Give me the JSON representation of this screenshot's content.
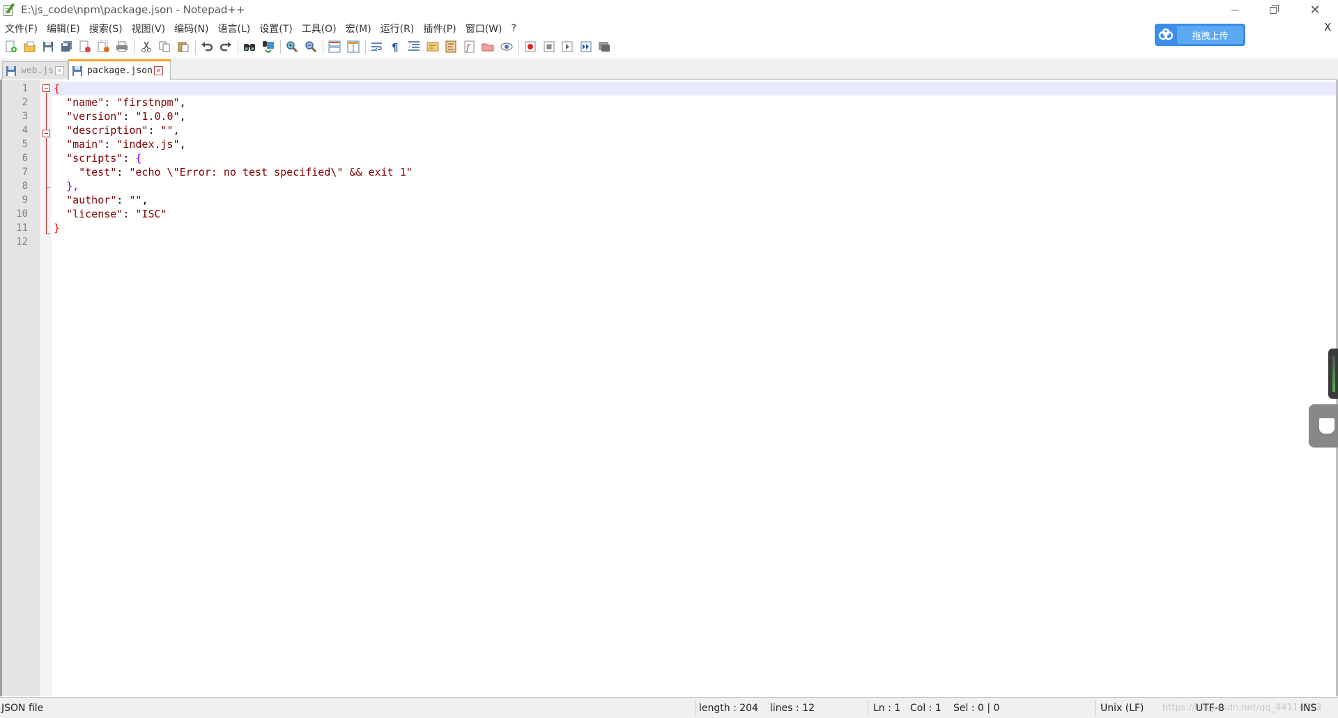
{
  "window": {
    "title": "E:\\js_code\\npm\\package.json - Notepad++"
  },
  "menu": {
    "items": [
      "文件(F)",
      "编辑(E)",
      "搜索(S)",
      "视图(V)",
      "编码(N)",
      "语言(L)",
      "设置(T)",
      "工具(O)",
      "宏(M)",
      "运行(R)",
      "插件(P)",
      "窗口(W)",
      "?"
    ],
    "close_x": "X"
  },
  "upload": {
    "label": "拖拽上传"
  },
  "toolbar": {
    "icons": [
      "new-file-icon",
      "open-file-icon",
      "save-icon",
      "save-all-icon",
      "close-icon",
      "close-all-icon",
      "print-icon",
      "cut-icon",
      "copy-icon",
      "paste-icon",
      "undo-icon",
      "redo-icon",
      "find-icon",
      "replace-icon",
      "zoom-in-icon",
      "zoom-out-icon",
      "sync-vertical-icon",
      "sync-horizontal-icon",
      "word-wrap-icon",
      "show-all-chars-icon",
      "indent-guide-icon",
      "user-language-icon",
      "doc-map-icon",
      "function-list-icon",
      "folder-workspace-icon",
      "monitor-icon",
      "record-macro-icon",
      "stop-macro-icon",
      "play-macro-icon",
      "run-macro-multiple-icon",
      "save-macro-icon"
    ]
  },
  "tabs": [
    {
      "label": "web.js",
      "active": false
    },
    {
      "label": "package.json",
      "active": true
    }
  ],
  "editor": {
    "lines": [
      [
        {
          "t": "{",
          "c": "brace"
        }
      ],
      [
        {
          "t": "  ",
          "c": "op"
        },
        {
          "t": "\"name\"",
          "c": "key"
        },
        {
          "t": ": ",
          "c": "op"
        },
        {
          "t": "\"firstnpm\"",
          "c": "str"
        },
        {
          "t": ",",
          "c": "op"
        }
      ],
      [
        {
          "t": "  ",
          "c": "op"
        },
        {
          "t": "\"version\"",
          "c": "key"
        },
        {
          "t": ": ",
          "c": "op"
        },
        {
          "t": "\"1.0.0\"",
          "c": "str"
        },
        {
          "t": ",",
          "c": "op"
        }
      ],
      [
        {
          "t": "  ",
          "c": "op"
        },
        {
          "t": "\"description\"",
          "c": "key"
        },
        {
          "t": ": ",
          "c": "op"
        },
        {
          "t": "\"\"",
          "c": "str"
        },
        {
          "t": ",",
          "c": "op"
        }
      ],
      [
        {
          "t": "  ",
          "c": "op"
        },
        {
          "t": "\"main\"",
          "c": "key"
        },
        {
          "t": ": ",
          "c": "op"
        },
        {
          "t": "\"index.js\"",
          "c": "str"
        },
        {
          "t": ",",
          "c": "op"
        }
      ],
      [
        {
          "t": "  ",
          "c": "op"
        },
        {
          "t": "\"scripts\"",
          "c": "key"
        },
        {
          "t": ": ",
          "c": "op"
        },
        {
          "t": "{",
          "c": "inner"
        }
      ],
      [
        {
          "t": "    ",
          "c": "op"
        },
        {
          "t": "\"test\"",
          "c": "key"
        },
        {
          "t": ": ",
          "c": "op"
        },
        {
          "t": "\"echo \\\"Error: no test specified\\\" && exit 1\"",
          "c": "str"
        }
      ],
      [
        {
          "t": "  ",
          "c": "op"
        },
        {
          "t": "},",
          "c": "inner"
        }
      ],
      [
        {
          "t": "  ",
          "c": "op"
        },
        {
          "t": "\"author\"",
          "c": "key"
        },
        {
          "t": ": ",
          "c": "op"
        },
        {
          "t": "\"\"",
          "c": "str"
        },
        {
          "t": ",",
          "c": "op"
        }
      ],
      [
        {
          "t": "  ",
          "c": "op"
        },
        {
          "t": "\"license\"",
          "c": "key"
        },
        {
          "t": ": ",
          "c": "op"
        },
        {
          "t": "\"ISC\"",
          "c": "str"
        }
      ],
      [
        {
          "t": "}",
          "c": "brace"
        }
      ],
      []
    ],
    "line_numbers": [
      "1",
      "2",
      "3",
      "4",
      "5",
      "6",
      "7",
      "8",
      "9",
      "10",
      "11",
      "12"
    ]
  },
  "status": {
    "file_type": "JSON file",
    "length": "length : 204",
    "lines": "lines : 12",
    "ln": "Ln : 1",
    "col": "Col : 1",
    "sel": "Sel : 0 | 0",
    "eol": "Unix (LF)",
    "encoding": "UTF-8",
    "mode": "INS",
    "watermark": "https://blog.csdn.net/qq_44114913"
  },
  "colors": {
    "key": "#800000",
    "brace": "#ff0000",
    "inner_brace": "#8000ff",
    "active_tab_accent": "#f5a623",
    "upload_blue": "#3b8ee8"
  }
}
